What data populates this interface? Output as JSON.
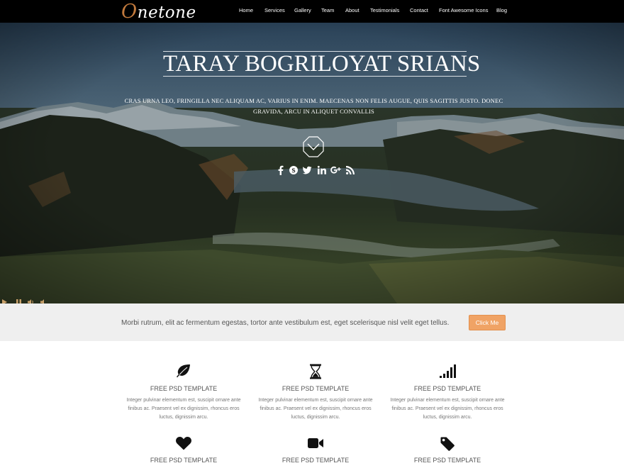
{
  "nav": {
    "logo": "Onetone",
    "logo_first_letter": "O",
    "logo_rest": "netone",
    "items": [
      {
        "label": "Home"
      },
      {
        "label": "Services"
      },
      {
        "label": "Gallery"
      },
      {
        "label": "Team"
      },
      {
        "label": "About"
      },
      {
        "label": "Testimonials"
      },
      {
        "label": "Contact"
      },
      {
        "label": "Font Awesome Icons"
      },
      {
        "label": "Blog"
      }
    ]
  },
  "hero": {
    "title": "TARAY BOGRILOYAT SRIANS",
    "subtitle": "CRAS URNA LEO, FRINGILLA NEC ALIQUAM AC, VARIUS IN ENIM. MAECENAS NON FELIS AUGUE, QUIS SAGITTIS JUSTO. DONEC GRAVIDA, ARCU IN ALIQUET CONVALLIS",
    "down_icon": "chevron-down-icon",
    "social_icons": [
      "facebook-icon",
      "skype-icon",
      "twitter-icon",
      "linkedin-icon",
      "google-plus-icon",
      "rss-icon"
    ],
    "player_icons": [
      "play-icon",
      "pause-icon",
      "volume-icon",
      "mute-icon"
    ]
  },
  "cta": {
    "text": "Morbi rutrum, elit ac fermentum egestas, tortor ante vestibulum est, eget scelerisque nisl velit eget tellus.",
    "button": "Click Me"
  },
  "features": [
    {
      "icon": "leaf-icon",
      "title": "FREE PSD TEMPLATE",
      "text": "Integer pulvinar elementum est, suscipit ornare ante finibus ac. Praesent vel ex dignissim, rhoncus eros luctus, dignissim arcu."
    },
    {
      "icon": "hourglass-icon",
      "title": "FREE PSD TEMPLATE",
      "text": "Integer pulvinar elementum est, suscipit ornare ante finibus ac. Praesent vel ex dignissim, rhoncus eros luctus, dignissim arcu."
    },
    {
      "icon": "signal-icon",
      "title": "FREE PSD TEMPLATE",
      "text": "Integer pulvinar elementum est, suscipit ornare ante finibus ac. Praesent vel ex dignissim, rhoncus eros luctus, dignissim arcu."
    },
    {
      "icon": "heart-icon",
      "title": "FREE PSD TEMPLATE",
      "text": ""
    },
    {
      "icon": "video-camera-icon",
      "title": "FREE PSD TEMPLATE",
      "text": ""
    },
    {
      "icon": "tag-icon",
      "title": "FREE PSD TEMPLATE",
      "text": ""
    }
  ],
  "colors": {
    "nav_bg": "#000000",
    "logo_accent": "#c27a3d",
    "cta_bg": "#efefef",
    "cta_button": "#f0a365"
  }
}
